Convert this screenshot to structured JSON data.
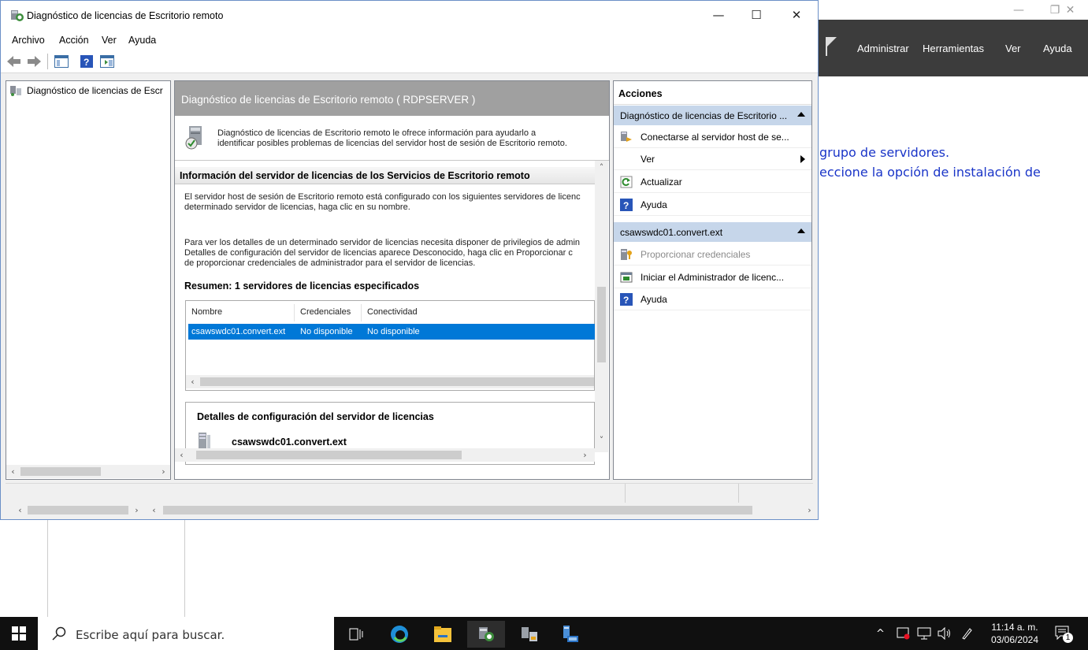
{
  "background": {
    "menu": [
      "Administrar",
      "Herramientas",
      "Ver",
      "Ayuda"
    ],
    "link_line1": "grupo de servidores.",
    "link_line2": "eccione la opción de instalación de"
  },
  "window": {
    "title": "Diagnóstico de licencias de Escritorio remoto",
    "controls": {
      "minimize": "—",
      "maximize": "☐",
      "close": "✕"
    }
  },
  "menu": [
    "Archivo",
    "Acción",
    "Ver",
    "Ayuda"
  ],
  "tree": {
    "item": "Diagnóstico de licencias de Escr"
  },
  "center": {
    "header": "Diagnóstico de licencias de Escritorio remoto ( RDPSERVER )",
    "intro_line1": "Diagnóstico de licencias de Escritorio remoto le ofrece información para ayudarlo a",
    "intro_line2": "identificar posibles problemas de licencias del servidor host de sesión de Escritorio remoto.",
    "section_title": "Información del servidor de licencias de los Servicios de Escritorio remoto",
    "para1_line1": "El servidor host de sesión de Escritorio remoto está configurado con los siguientes servidores de licenc",
    "para1_line2": "determinado servidor de licencias, haga clic en su nombre.",
    "para2_line1": "Para ver los detalles de un determinado servidor de licencias necesita disponer de privilegios de admin",
    "para2_line2": "Detalles de configuración del servidor de licencias aparece Desconocido, haga clic en Proporcionar c",
    "para2_line3": "de proporcionar credenciales de administrador para el servidor de licencias.",
    "summary": "Resumen: 1 servidores de licencias especificados",
    "columns": [
      "Nombre",
      "Credenciales",
      "Conectividad"
    ],
    "rows": [
      {
        "name": "csawswdc01.convert.ext",
        "credentials": "No disponible",
        "connectivity": "No disponible"
      }
    ],
    "details_title": "Detalles de configuración del servidor de licencias",
    "details_server": "csawswdc01.convert.ext"
  },
  "actions": {
    "header": "Acciones",
    "group1": "Diagnóstico de licencias de Escritorio ...",
    "group1_items": [
      {
        "label": "Conectarse al servidor host de se...",
        "icon": "connect-server-icon"
      },
      {
        "label": "Ver",
        "icon": "none"
      },
      {
        "label": "Actualizar",
        "icon": "refresh-icon"
      },
      {
        "label": "Ayuda",
        "icon": "help-icon"
      }
    ],
    "group2": "csawswdc01.convert.ext",
    "group2_items": [
      {
        "label": "Proporcionar credenciales",
        "icon": "credentials-icon",
        "disabled": true
      },
      {
        "label": "Iniciar el Administrador de licenc...",
        "icon": "license-manager-icon"
      },
      {
        "label": "Ayuda",
        "icon": "help-icon"
      }
    ]
  },
  "taskbar": {
    "search_placeholder": "Escribe aquí para buscar.",
    "time": "11:14 a. m.",
    "date": "03/06/2024",
    "notification_count": "1"
  },
  "colors": {
    "selection": "#0078d7",
    "action_group": "#c6d6ea",
    "center_header": "#a0a0a0",
    "link": "#1a35c8"
  }
}
